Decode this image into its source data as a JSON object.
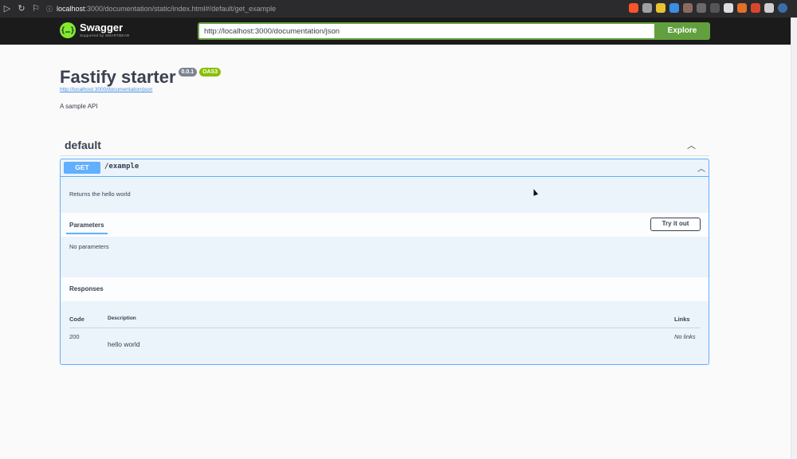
{
  "browser": {
    "url_host": "localhost",
    "url_path": ":3000/documentation/static/index.html#/default/get_example",
    "nav_icons": [
      "back-icon",
      "reload-icon",
      "bookmark-icon"
    ],
    "extensions": [
      "brave-icon",
      "brave-rewards-icon",
      "extension-icon",
      "extension-icon",
      "extension-icon",
      "extension-icon",
      "extension-icon",
      "extension-icon",
      "extension-icon",
      "extension-icon",
      "extensions-puzzle-icon",
      "profile-icon"
    ]
  },
  "topbar": {
    "logo_name": "Swagger",
    "logo_sub": "Supported by SMARTBEAR",
    "spec_url": "http://localhost:3000/documentation/json",
    "explore_label": "Explore",
    "accent_color": "#62a03f"
  },
  "info": {
    "title": "Fastify starter",
    "version": "0.0.1",
    "oas_badge": "OAS3",
    "spec_link": "http://localhost:3000/documentation/json",
    "description": "A sample API"
  },
  "tag": {
    "name": "default"
  },
  "operation": {
    "method": "GET",
    "path": "/example",
    "description": "Returns the hello world",
    "method_color": "#61affe",
    "parameters_tab": "Parameters",
    "try_it_out_label": "Try it out",
    "no_parameters": "No parameters",
    "responses_title": "Responses",
    "responses_table": {
      "columns": [
        "Code",
        "Description",
        "Links"
      ],
      "rows": [
        {
          "code": "200",
          "description": "hello world",
          "links": "No links"
        }
      ]
    }
  }
}
